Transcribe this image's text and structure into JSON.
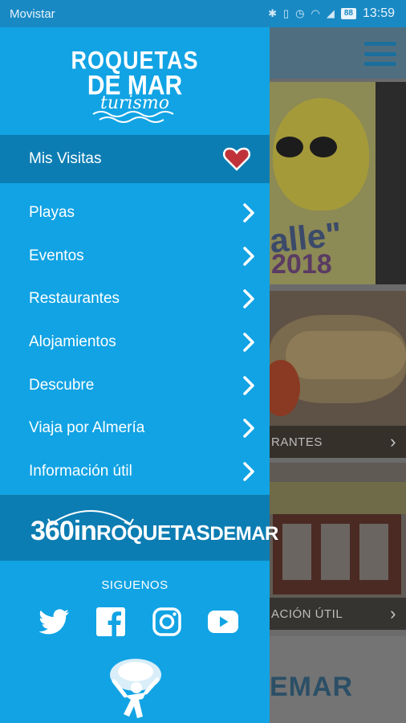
{
  "status_bar": {
    "carrier": "Movistar",
    "battery": "88",
    "time": "13:59",
    "icons": [
      "bluetooth-icon",
      "vibrate-icon",
      "alarm-icon",
      "wifi-icon",
      "signal-icon",
      "battery-icon"
    ]
  },
  "drawer": {
    "logo": {
      "line1": "ROQUETAS",
      "line2": "DE MAR",
      "line3": "turismo"
    },
    "favorites": {
      "label": "Mis Visitas",
      "icon": "heart-icon"
    },
    "menu_items": [
      {
        "label": "Playas"
      },
      {
        "label": "Eventos"
      },
      {
        "label": "Restaurantes"
      },
      {
        "label": "Alojamientos"
      },
      {
        "label": "Descubre"
      },
      {
        "label": "Viaja por Almería"
      },
      {
        "label": "Información útil"
      }
    ],
    "banner": {
      "part1": "360in",
      "part2": "ROQUETAS",
      "part3": "DEMAR"
    },
    "follow_label": "SIGUENOS",
    "socials": [
      "twitter-icon",
      "facebook-icon",
      "instagram-icon",
      "youtube-icon"
    ]
  },
  "background": {
    "promo_text1": "alle\"",
    "promo_text2": "2018",
    "cards": [
      {
        "label": "RANTES"
      },
      {
        "label": "ACIÓN ÚTIL"
      }
    ],
    "mar_text": "EMAR"
  },
  "colors": {
    "drawer": "#11a3e4",
    "drawer_dark": "#0c7db3",
    "status_bar": "#1989c4",
    "heart": "#c0323a"
  }
}
